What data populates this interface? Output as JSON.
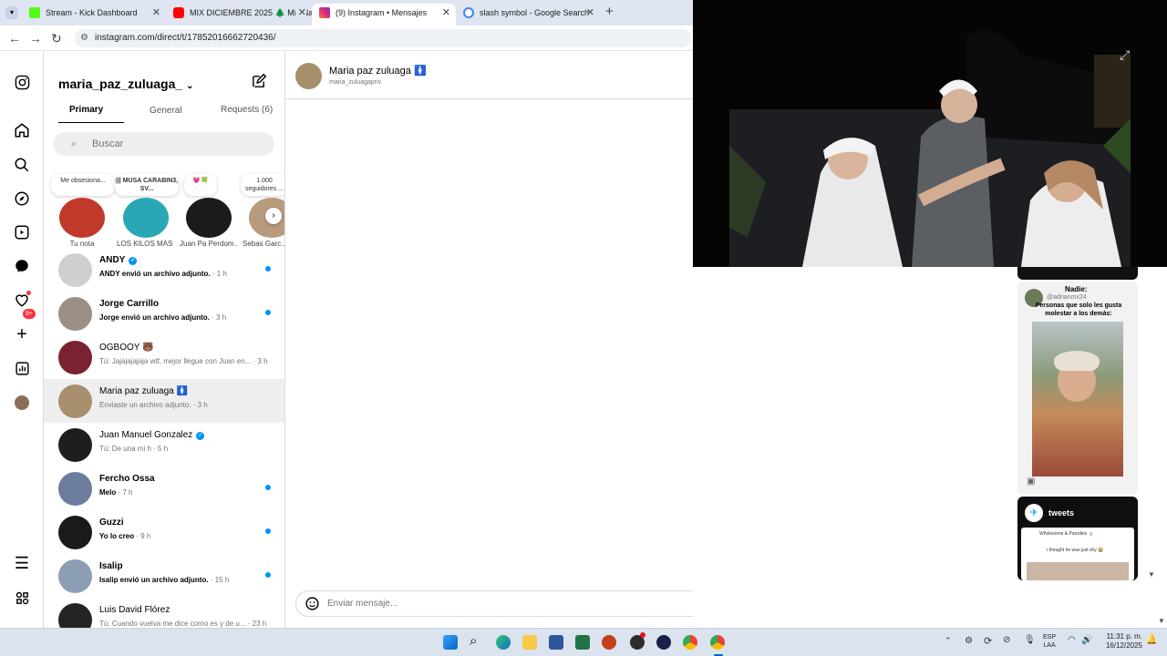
{
  "browser": {
    "tabs": [
      {
        "title": "Stream - Kick Dashboard",
        "icon": "kick-icon",
        "color": "#53fc18"
      },
      {
        "title": "MIX DICIEMBRE 2025 🌲 Mix Na",
        "icon": "youtube-icon",
        "color": "#ff0000"
      },
      {
        "title": "(9) Instagram • Mensajes",
        "icon": "instagram-icon",
        "color": "#e1306c"
      },
      {
        "title": "slash symbol - Google Search",
        "icon": "google-icon",
        "color": "#4285f4"
      }
    ],
    "url": "instagram.com/direct/t/17852016662720436/"
  },
  "rail": {
    "notification_badge": "9+"
  },
  "inbox": {
    "username": "maria_paz_zuluaga_",
    "tabs": [
      "Primary",
      "General",
      "Requests (6)"
    ],
    "search_placeholder": "Buscar",
    "notes": [
      {
        "text": "Me obsesiona..."
      },
      {
        "text": "||| MUSA CARABIN3, SV..."
      },
      {
        "text": "💗🍀"
      },
      {
        "text": "1.000 seguidores ..."
      }
    ],
    "stories": [
      {
        "label": "Tu nota",
        "color": "#c0392b"
      },
      {
        "label": "LOS KILOS MAS ...",
        "color": "#2aa7b5"
      },
      {
        "label": "Juan Pa Perdom...",
        "color": "#1b1b1b"
      },
      {
        "label": "Sebas Garc...",
        "color": "#b89a7c"
      }
    ],
    "conversations": [
      {
        "name": "ANDY",
        "verified": true,
        "preview": "ANDY envió un archivo adjunto.",
        "time": "· 1 h",
        "unread": true,
        "color": "#cfcfcf"
      },
      {
        "name": "Jorge Carrillo",
        "verified": false,
        "preview": "Jorge envió un archivo adjunto.",
        "time": "· 3 h",
        "unread": true,
        "color": "#9b8f86"
      },
      {
        "name": "OGBOOY 🐻",
        "verified": false,
        "preview": "Tú: Jajajajajaja wtf, mejor llegue con Juan en...",
        "time": "· 3 h",
        "unread": false,
        "color": "#7a2230"
      },
      {
        "name": "Maria paz zuluaga 🚺",
        "verified": false,
        "preview": "Enviaste un archivo adjunto.",
        "time": "· 3 h",
        "unread": false,
        "color": "#a88f6e",
        "selected": true
      },
      {
        "name": "Juan Manuel Gonzalez",
        "verified": true,
        "preview": "Tú: De una mi h",
        "time": "· 5 h",
        "unread": false,
        "color": "#1e1e1e"
      },
      {
        "name": "Fercho Ossa",
        "verified": false,
        "preview": "Melo",
        "time": "· 7 h",
        "unread": true,
        "color": "#6c7c9c"
      },
      {
        "name": "Guzzi",
        "verified": false,
        "preview": "Yo lo creo",
        "time": "· 9 h",
        "unread": true,
        "color": "#1a1a1a"
      },
      {
        "name": "Isalip",
        "verified": false,
        "preview": "Isalip envió un archivo adjunto.",
        "time": "· 15 h",
        "unread": true,
        "color": "#8d9fb4"
      },
      {
        "name": "Luis David Flórez",
        "verified": false,
        "preview": "Tú: Cuando vuelva me dice como es y de u...",
        "time": "· 23 h",
        "unread": false,
        "color": "#242424"
      }
    ]
  },
  "chat": {
    "name": "Maria paz zuluaga 🚺",
    "handle": "maria_zuluagapriv",
    "message_placeholder": "Enviar mensaje..."
  },
  "feed": {
    "card1_top": "Nadie:",
    "card1_handle": "@adrianmx24",
    "card1_caption": "Personas que solo les gusta molestar a los demás:",
    "card2_title": "tweets",
    "card2_sub": "Wholesome & Parodies 🍵",
    "card2_tweet": "i thought he was just shy 😭"
  },
  "taskbar": {
    "lang": "ESP",
    "layout": "LAA",
    "time": "11:31 p. m.",
    "date": "16/12/2025"
  }
}
